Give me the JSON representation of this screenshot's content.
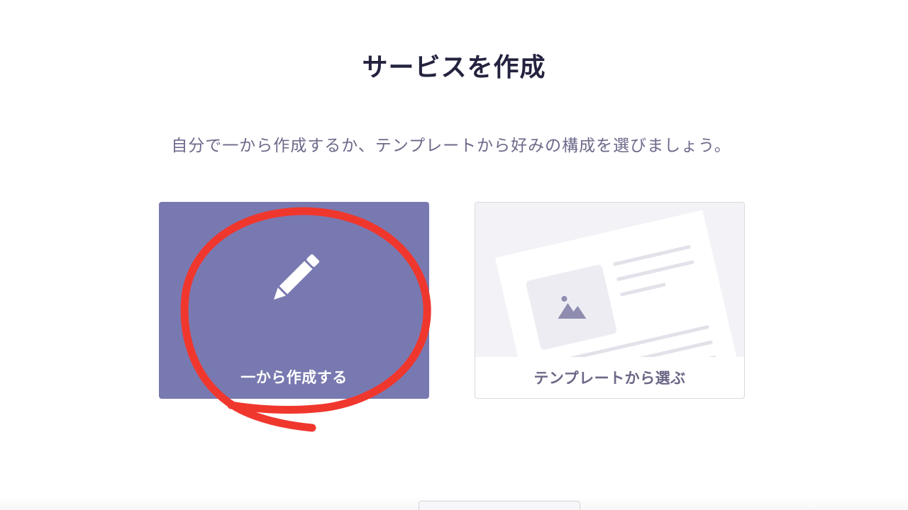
{
  "page": {
    "title": "サービスを作成",
    "subtitle": "自分で一から作成するか、テンプレートから好みの構成を選びましょう。"
  },
  "options": {
    "scratch": {
      "label": "一から作成する",
      "icon": "pencil-icon"
    },
    "template": {
      "label": "テンプレートから選ぶ",
      "icon": "template-document-illustration"
    }
  },
  "colors": {
    "title": "#23233f",
    "subtitle": "#6c6a8a",
    "scratch_card_bg": "#7979b1",
    "template_label": "#6a6786",
    "annotation": "#f0372e"
  }
}
